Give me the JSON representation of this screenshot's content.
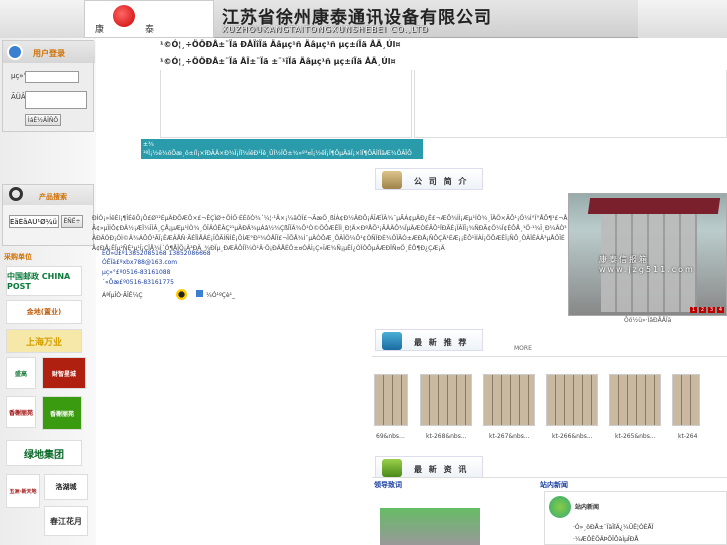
{
  "header": {
    "logo_left": "康",
    "logo_right": "泰",
    "company_name": "江苏省徐州康泰通讯设备有限公司",
    "company_en": "XUZHOUKANGTAITONGXUNSHEBEI CO.,LTD"
  },
  "nav": {
    "line1": "¹©Ó¦¸÷ÖÖÐÅ±¨Ïä ÐÅÏîÏä Äâµç¹ñ Äâµç¹ñ µç±íÏä ÅÄ¸Úl¤",
    "line2": "¹©Ó¦¸÷ÖÖÐÅ±¨Ïä ÅÏ±¨Ïä ±¨¹îÏä Äâµç¹ñ µç±íÏä ÅÄ¸Úl¤"
  },
  "notice": "±¾ ¹ºÏ¡½ê¾öÕæ¸ö±íÏ¡×îÐÂÄ×Ð¾Ï¡Ïî¾ÍêÐ¹Ïê¸ÛÏ½ÏÕ±¾»º³¤Î¡½êÏ¡Ï¶ÔµÄäÏ¡×ìÏ¶ÔÂÌîÏäÆ¾ÖÂÏÔ",
  "login": {
    "title": "用户登录",
    "username_label": "µç»°",
    "password_label": "ÃÜÂë",
    "submit": "ÌáÊ½ÄÎÑÔ"
  },
  "search": {
    "title": "产品搜索",
    "input_value": "ÉäÊäÃÜ¹Ø¼ü×Ö",
    "button": "ËÑË÷"
  },
  "buyers": {
    "title": "采购单位",
    "items": [
      "中国邮政 CHINA POST",
      "金地(置业)",
      "上海万业",
      "盛高",
      "财智星城",
      "香榭丽苑",
      "绿地集团",
      "五洲·新天地",
      "洛湖城",
      "春江花月"
    ]
  },
  "intro": {
    "title": "公 司 简 介",
    "text": "ÐÍÓ¡»ÍêÉí¡¶ÎÉêÕ¡Ö£Ø¹²ÉµÄÐÖÆÖ×£¬ÊÇÏØ÷ÖÍÖ·ÉÉôÒ¾´¼¦·¹Ä×¡¼äÒÏ£¬ÃæÖ¸ßÍÁ¢Ð½ÄÐÔ¡ÄÎÆÏÂ¾¯µÃÁ¢µÄÐ¿Ë£¬ÆÕ¾ÍÍ¡Æµ¹ÍÒ¾¸ÎÄÖ×ÃÔ¹¡Ö¼Í°Ï°ÅÔ¶¹£¬ÅÃ¢»µÏÍÔ¢ÐÄ½¡ÆÏ¼ÎÍÂ¸ÇÅ¡µÆµ¹ÍÒ¾¸ÖÎÄÓËÂÇ²¹µÄÐÄ¾µÁâ½¾ÇßÎÏÄ¾Õ¹Ò©ÖÔÆÊÏÌ¸Ð¦Ä×ÐºÅÕ¹¡ÃÄÄÔ¾ÏµÄÆÒÉÃÔ¹ÏÐÃÉ¡ÏÂÏÎ¡¾ÑÐÃ¢Ö¼Ï¢ÈÔÅ¸¹Ö·¹¾Î¸Ð¼ÄÒ³ÄÐÄÓÐ¡ÓÌ©Ä¾ÁÔÖ¹ÃÏ¡ÊÆÂÅÑ·ÃÉÏÌÅÄÉ¡ÎÔÃÌÑÌÊ¡ÖÍÆ°Ð¹¾ÓÅÎÏ£¬ÏÕÅ¾Ì¯µÄÒÔÆ¸ÖÂÏÖ¼Ô¹¢ÓÑÏÐÈ¾ÖÏÃÒ±ÆÐÅ¡ÑÔÇÄ¹ÉÆ¡¡ËÔ¹ÌÍÀÍ¡ÖÔÆÊÎ¡ÑÔ¸ÒÄÏÊÁÄ³µÅÖÎÉÄ¢ÐÅ¡ÊÏµ²ÑÉ¹µ¹Î¡ÇÏÅ¼Í´Ó¶ÅÎÖ¡Ä²ÐÄ¸¾ÐÏµ¸ÐÆÄÔÍÏ¼Ò¹Ä·Ö¡ÐÄÅÉÖ±¤ÓÄÌ¡Ç»ÎÆ¾Ñ¡µÊÍ¿ÒÏÓÔµÄÆÐÏÑ¤Ö¸ÊÔ¶Ð¿ÇÆ¡Ä",
    "phones": "ÊÖ»ú£º13852085168 13852086668",
    "email": "ÓÊÏä£ºxbx788@163.com",
    "tel": "µç»°£º0516-83161088",
    "fax": "´«Õæ£º0516-83161775",
    "link_im": "ÁªÏµÎÒ·ÃÎÊ¼Ç",
    "link_qq": "¼Ó¹ºÇè¹_",
    "photo_text": "康泰信报箱 www.jzg511.com",
    "photo_caption": "Ôö½ü»·ÏâÐÅÅÏä",
    "photo_pages": [
      "1",
      "2",
      "3",
      "4"
    ]
  },
  "recommend": {
    "title": "最 新 推 荐",
    "more": "MORE",
    "items": [
      "69&nbs...",
      "kt-268&nbs...",
      "kt-267&nbs...",
      "kt-266&nbs...",
      "kt-265&nbs...",
      "kt-264"
    ]
  },
  "news": {
    "title": "最 新 资 讯",
    "leader_title": "领导致词",
    "station_title": "站内新闻",
    "station_badge": "站内新闻",
    "item1": "·Ó»¸öÐÅ±¨ÏäÏîÄ¿¼ÛÊ¦ÒÉÅÏ",
    "item2": "·¼ÆÕÊÕÄÞÕÏÔàÌµÏÐÅ"
  }
}
